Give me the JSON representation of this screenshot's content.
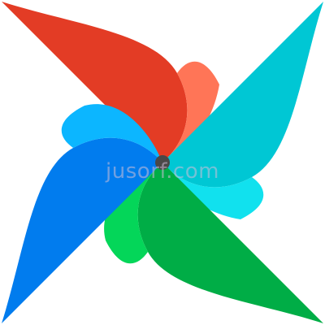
{
  "logo": {
    "name": "pinwheel-logo",
    "colors": {
      "red_blade": "#E33C25",
      "red_blade_light": "#FF7557",
      "teal_blade": "#00C7D4",
      "teal_blade_light": "#11E1EE",
      "green_blade": "#00AD46",
      "green_blade_light": "#04D659",
      "blue_blade": "#017CEE",
      "blue_blade_light": "#0CB6FF",
      "center_dot": "#4A4848"
    }
  },
  "watermark": {
    "text": "jusorf.com"
  }
}
